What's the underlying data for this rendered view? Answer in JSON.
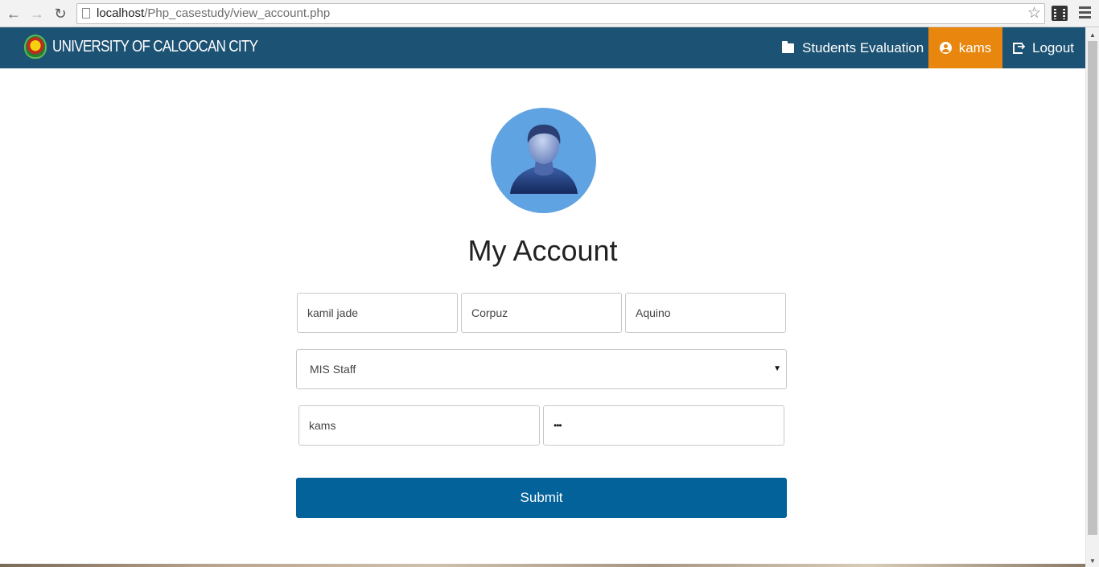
{
  "browser": {
    "url_host": "localhost",
    "url_path": "/Php_casestudy/view_account.php"
  },
  "navbar": {
    "brand": "UNIVERSITY OF CALOOCAN CITY",
    "items": [
      {
        "label": "Students Evaluation",
        "icon": "folder-open-icon"
      },
      {
        "label": "kams",
        "icon": "user-circle-icon",
        "active": true
      },
      {
        "label": "Logout",
        "icon": "sign-out-icon"
      }
    ],
    "colors": {
      "bar": "#1c5273",
      "active": "#e8860d"
    }
  },
  "page": {
    "title": "My Account"
  },
  "form": {
    "first_name": "kamil jade",
    "last_name": "Corpuz",
    "middle_name": "Aquino",
    "role": "MIS Staff",
    "username": "kams",
    "password": "•••",
    "submit_label": "Submit",
    "submit_color": "#03629a"
  }
}
